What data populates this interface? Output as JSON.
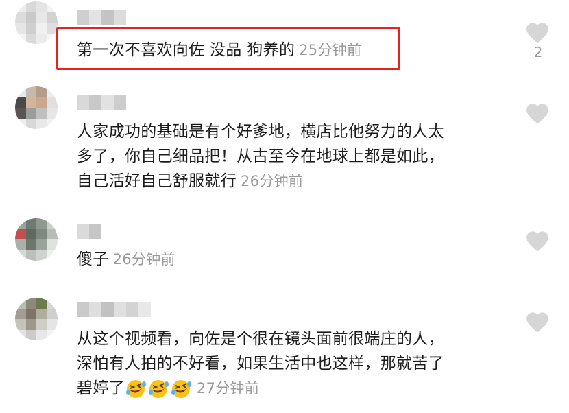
{
  "comments": [
    {
      "text": "第一次不喜欢向佐 没品 狗养的",
      "time": "25分钟前",
      "likes": "2",
      "highlighted": true
    },
    {
      "lines": [
        "人家成功的基础是有个好爹地，横店比他努力的人太",
        "多了，你自己细品把！从古至今在地球上都是如此，",
        "自己活好自己舒服就行"
      ],
      "time": "26分钟前"
    },
    {
      "text": "傻子",
      "time": "26分钟前"
    },
    {
      "lines": [
        "从这个视频看，向佐是个很在镜头面前很端庄的人，",
        "深怕有人拍的不好看，如果生活中也这样，那就苦了",
        "碧婷了"
      ],
      "emojis": [
        "rolling-on-floor-laughing",
        "rolling-on-floor-laughing",
        "rolling-on-floor-laughing"
      ],
      "time": "27分钟前"
    }
  ],
  "colors": {
    "highlight_border": "#e8231f",
    "timestamp": "#9a9a9a",
    "heart": "#d6d6d6"
  },
  "icons": {
    "like": "heart-icon"
  }
}
